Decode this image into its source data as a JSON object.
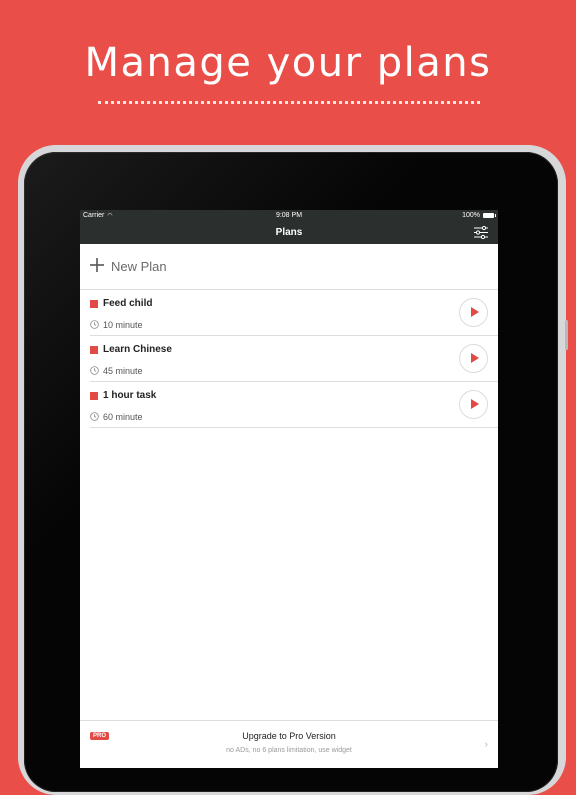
{
  "headline": "Manage your plans",
  "colors": {
    "background": "#ea4e48",
    "accent": "#e24a44",
    "bar": "#2b2f2d"
  },
  "status_bar": {
    "carrier": "Carrier",
    "time": "9:08 PM",
    "battery": "100%"
  },
  "nav": {
    "title": "Plans",
    "settings_icon": "sliders-icon"
  },
  "new_plan": {
    "label": "New Plan"
  },
  "plans": [
    {
      "name": "Feed child",
      "duration": "10 minute"
    },
    {
      "name": "Learn Chinese",
      "duration": "45 minute"
    },
    {
      "name": "1 hour task",
      "duration": "60 minute"
    }
  ],
  "upgrade": {
    "badge": "PRO",
    "title": "Upgrade to Pro Version",
    "subtitle": "no ADs, no 6 plans limitation, use widget"
  }
}
